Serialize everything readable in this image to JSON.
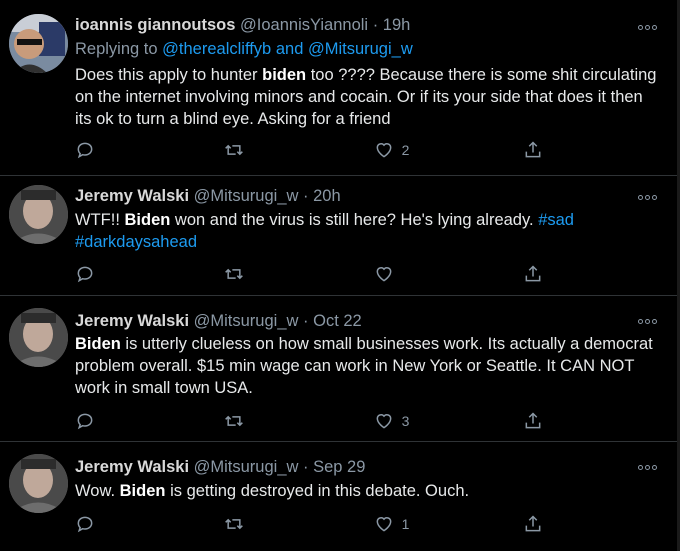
{
  "tweets": [
    {
      "name": "ioannis giannoutsos",
      "handle": "@IoannisYiannoli",
      "dot": "·",
      "time": "19h",
      "reply_prefix": "Replying to",
      "reply_user1": "@therealcliffyb",
      "reply_and": "and",
      "reply_user2": "@Mitsurugi_w",
      "text_pre": "Does this apply to hunter ",
      "text_bold": "biden",
      "text_post": " too ???? Because there is some shit circulating on the internet involving minors and cocain.  Or if its your side that does it then its ok to turn a blind eye.  Asking for a friend",
      "likes": "2"
    },
    {
      "name": "Jeremy Walski",
      "handle": "@Mitsurugi_w",
      "dot": "·",
      "time": "20h",
      "text_pre": "WTF!!  ",
      "text_bold": "Biden",
      "text_post": " won and the virus is still here?  He's lying already.  ",
      "hashtag1": "#sad",
      "hashtag2": "#darkdaysahead",
      "likes": ""
    },
    {
      "name": "Jeremy Walski",
      "handle": "@Mitsurugi_w",
      "dot": "·",
      "time": "Oct 22",
      "text_pre": "",
      "text_bold": "Biden",
      "text_post": " is utterly clueless on how small businesses work.  Its actually a democrat problem overall.  $15 min wage can work in New York or Seattle.  It CAN NOT work in small town USA.",
      "likes": "3"
    },
    {
      "name": "Jeremy Walski",
      "handle": "@Mitsurugi_w",
      "dot": "·",
      "time": "Sep 29",
      "text_pre": "Wow. ",
      "text_bold": "Biden",
      "text_post": " is getting destroyed in this debate. Ouch.",
      "likes": "1"
    }
  ],
  "icons": {
    "reply": "reply-icon",
    "retweet": "retweet-icon",
    "like": "heart-icon",
    "share": "share-icon",
    "more": "more-icon"
  },
  "colors": {
    "background": "#000000",
    "link": "#1d9bf0",
    "muted": "#8b98a5",
    "divider": "#2f3336"
  }
}
